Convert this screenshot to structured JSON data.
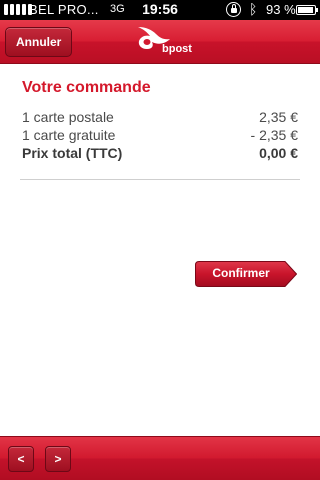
{
  "status_bar": {
    "carrier": "BEL PRO...",
    "network": "3G",
    "time": "19:56",
    "battery_percent": "93 %",
    "icons": [
      "signal-icon",
      "orientation-lock-icon",
      "bluetooth-icon",
      "battery-icon"
    ],
    "battery_level": 0.93
  },
  "navbar": {
    "cancel_label": "Annuler",
    "logo_text": "bpost"
  },
  "order": {
    "title": "Votre commande",
    "lines": [
      {
        "label": "1 carte postale",
        "amount": "2,35 €"
      },
      {
        "label": "1 carte gratuite",
        "amount": "- 2,35 €"
      }
    ],
    "total_label": "Prix total (TTC)",
    "total_amount": "0,00 €",
    "confirm_label": "Confirmer"
  },
  "toolbar": {
    "prev_label": "<",
    "next_label": ">"
  },
  "colors": {
    "brand_red": "#d81e33",
    "title_red": "#d4182b",
    "text_gray": "#4a4a4a"
  }
}
